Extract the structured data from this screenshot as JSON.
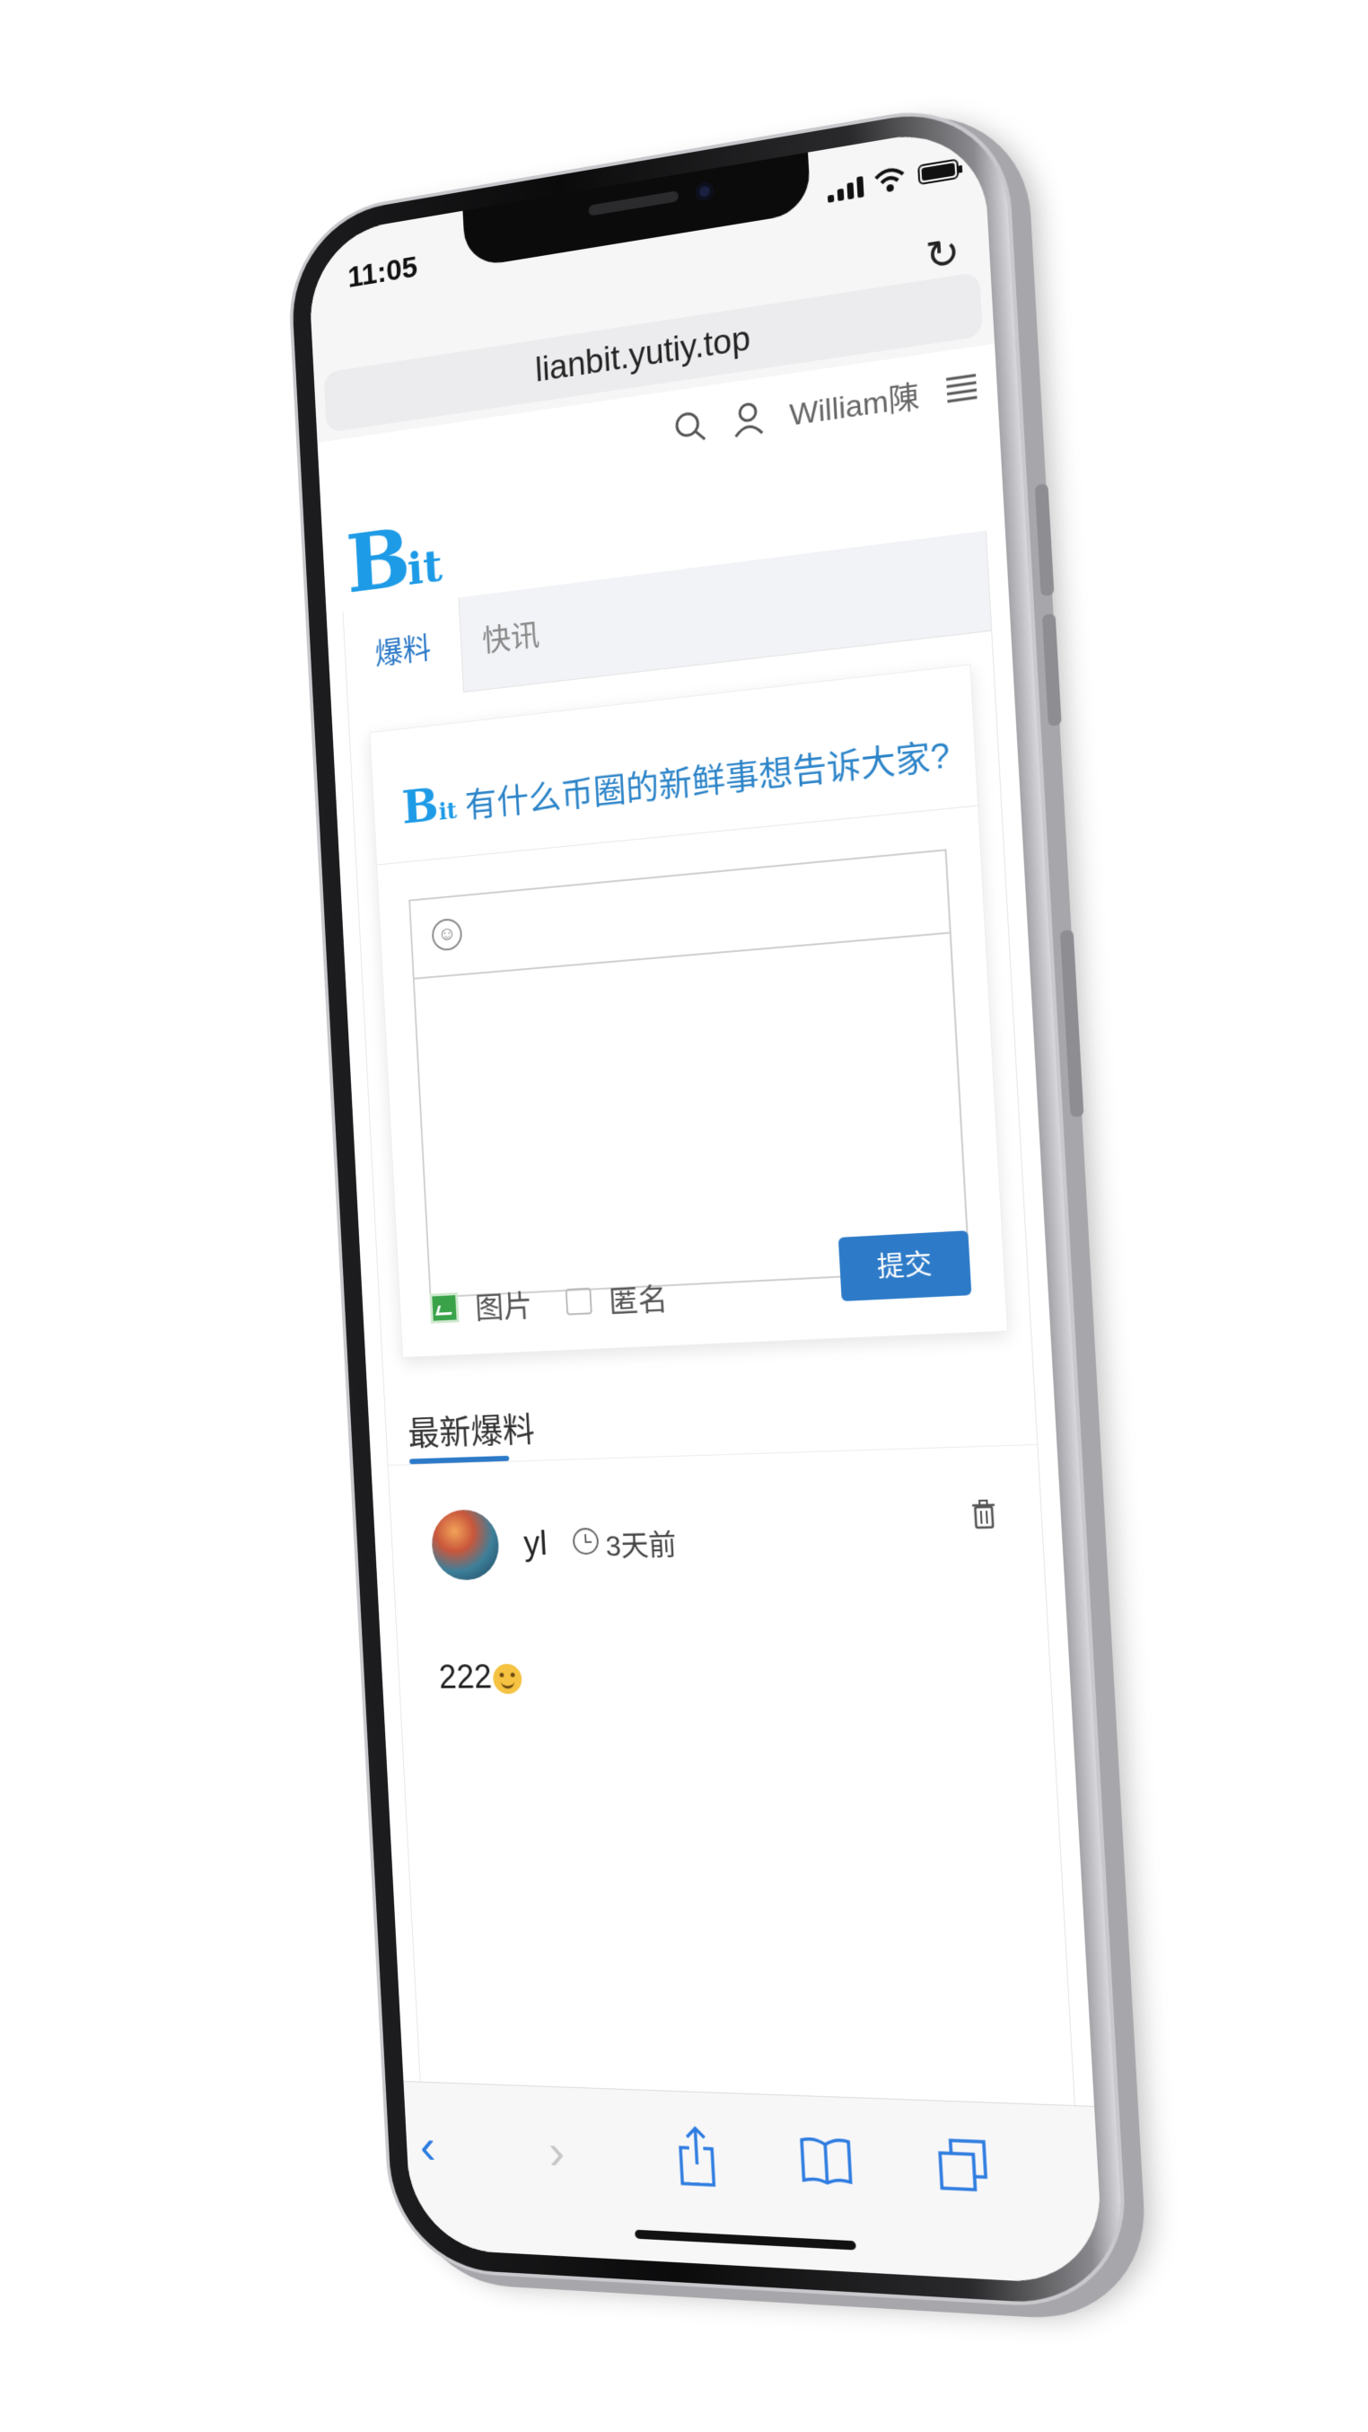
{
  "status_bar": {
    "time": "11:05"
  },
  "browser": {
    "url": "lianbit.yutiy.top",
    "refresh_icon": "refresh-icon",
    "toolbar": {
      "back_icon": "chevron-left-icon",
      "forward_icon": "chevron-right-icon",
      "share_icon": "share-icon",
      "bookmarks_icon": "book-icon",
      "tabs_icon": "tabs-icon"
    }
  },
  "site_header": {
    "logo_b": "B",
    "logo_it": "it",
    "user_name": "William陳",
    "icons": [
      "search-icon",
      "user-icon",
      "menu-icon"
    ]
  },
  "tabs": [
    "爆料",
    "快讯"
  ],
  "composer": {
    "prompt": "有什么币圈的新鲜事想告诉大家?",
    "image_label": "图片",
    "anonymous_label": "匿名",
    "submit_label": "提交"
  },
  "feed": {
    "title": "最新爆料",
    "posts": [
      {
        "user": "yl",
        "time_ago": "3天前",
        "content": "222"
      }
    ]
  },
  "colors": {
    "accent": "#2c79c8",
    "logo": "#1e9be6",
    "browser_blue": "#2c7be0"
  }
}
